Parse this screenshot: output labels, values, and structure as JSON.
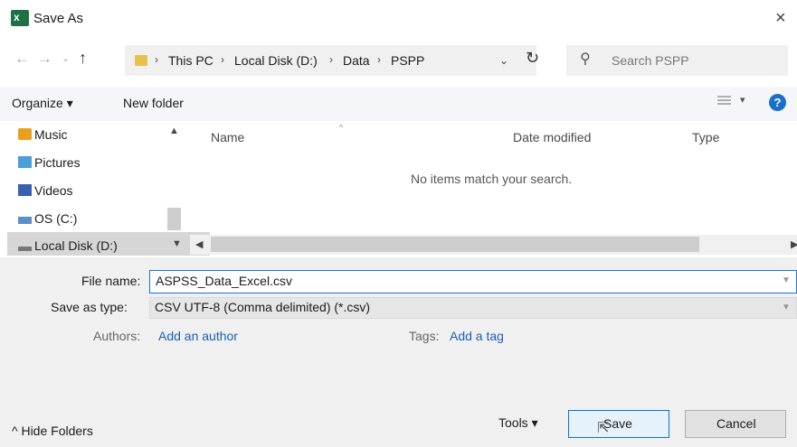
{
  "window": {
    "title": "Save As",
    "close_glyph": "×"
  },
  "nav": {
    "back": "←",
    "forward": "→",
    "recent": "⌄",
    "up": "↑"
  },
  "address": {
    "crumbs": [
      "This PC",
      "Local Disk (D:)",
      "Data",
      "PSPP"
    ],
    "separator": "›",
    "dropdown": "⌄",
    "refresh": "↻"
  },
  "search": {
    "placeholder": "Search PSPP",
    "icon": "⚲"
  },
  "toolbar": {
    "organize": "Organize ▾",
    "new_folder": "New folder",
    "view_dropdown": "▾",
    "help": "?"
  },
  "sidebar": {
    "items": [
      {
        "label": "Music",
        "icon": "music-icon",
        "color": "#e8a020"
      },
      {
        "label": "Pictures",
        "icon": "pictures-icon",
        "color": "#4a9fd8"
      },
      {
        "label": "Videos",
        "icon": "videos-icon",
        "color": "#3a5fb0"
      },
      {
        "label": "OS (C:)",
        "icon": "drive-icon",
        "color": "#5b8fc8"
      },
      {
        "label": "Local Disk (D:)",
        "icon": "drive-icon",
        "color": "#777777"
      }
    ],
    "selected_index": 4
  },
  "file_list": {
    "columns": [
      "Name",
      "Date modified",
      "Type"
    ],
    "sort_glyph": "^",
    "empty_message": "No items match your search."
  },
  "form": {
    "file_name_label": "File name:",
    "file_name_value": "ASPSS_Data_Excel.csv",
    "save_type_label": "Save as type:",
    "save_type_value": "CSV UTF-8 (Comma delimited) (*.csv)",
    "authors_label": "Authors:",
    "authors_link": "Add an author",
    "tags_label": "Tags:",
    "tags_link": "Add a tag"
  },
  "footer": {
    "hide_folders": "^ Hide Folders",
    "tools": "Tools  ▾",
    "save": "Save",
    "cancel": "Cancel"
  },
  "colors": {
    "accent": "#0078d7",
    "link": "#1a5fb4",
    "excel_green": "#1e7145"
  }
}
